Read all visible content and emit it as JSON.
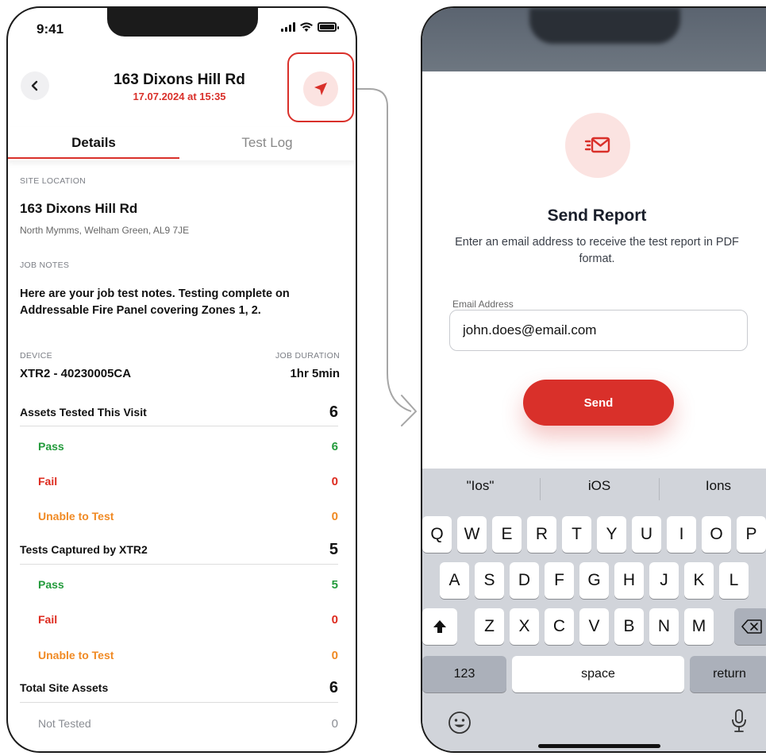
{
  "status_bar": {
    "time": "9:41"
  },
  "job": {
    "title": "163 Dixons Hill Rd",
    "datetime": "17.07.2024 at 15:35"
  },
  "tabs": [
    {
      "label": "Details",
      "active": true
    },
    {
      "label": "Test Log",
      "active": false
    }
  ],
  "site": {
    "section_label": "SITE LOCATION",
    "name": "163 Dixons Hill Rd",
    "address": "North Mymms, Welham Green,  AL9 7JE"
  },
  "notes": {
    "section_label": "JOB NOTES",
    "text": "Here are your job test notes. Testing complete on Addressable Fire Panel covering Zones 1, 2."
  },
  "device": {
    "label": "DEVICE",
    "value": "XTR2 - 40230005CA"
  },
  "duration": {
    "label": "JOB DURATION",
    "value": "1hr 5min"
  },
  "assets_tested": {
    "label": "Assets Tested This Visit",
    "value": "6",
    "pass": {
      "label": "Pass",
      "value": "6"
    },
    "fail": {
      "label": "Fail",
      "value": "0"
    },
    "unable": {
      "label": "Unable to Test",
      "value": "0"
    }
  },
  "tests_captured": {
    "label": "Tests Captured by XTR2",
    "value": "5",
    "pass": {
      "label": "Pass",
      "value": "5"
    },
    "fail": {
      "label": "Fail",
      "value": "0"
    },
    "unable": {
      "label": "Unable to Test",
      "value": "0"
    }
  },
  "total_assets": {
    "label": "Total Site Assets",
    "value": "6",
    "not_tested": {
      "label": "Not Tested",
      "value": "0"
    }
  },
  "send_report": {
    "title": "Send Report",
    "description": "Enter an email address to receive the test report in PDF format.",
    "email_label": "Email Address",
    "email_value": "john.does@email.com",
    "button_label": "Send"
  },
  "keyboard": {
    "suggestions": [
      "\"Ios\"",
      "iOS",
      "Ions"
    ],
    "row1": [
      "Q",
      "W",
      "E",
      "R",
      "T",
      "Y",
      "U",
      "I",
      "O",
      "P"
    ],
    "row2": [
      "A",
      "S",
      "D",
      "F",
      "G",
      "H",
      "J",
      "K",
      "L"
    ],
    "row3": [
      "Z",
      "X",
      "C",
      "V",
      "B",
      "N",
      "M"
    ],
    "numbers_key": "123",
    "space_key": "space",
    "return_key": "return"
  },
  "colors": {
    "accent": "#d9302a",
    "pass": "#239b3c",
    "fail": "#dd2b1f",
    "unable": "#f08a24",
    "muted": "#8a8d93"
  },
  "icons": [
    "chevron-left-icon",
    "send-icon",
    "mail-send-icon",
    "shift-icon",
    "backspace-icon",
    "emoji-icon",
    "microphone-icon",
    "signal-icon",
    "wifi-icon",
    "battery-icon"
  ]
}
